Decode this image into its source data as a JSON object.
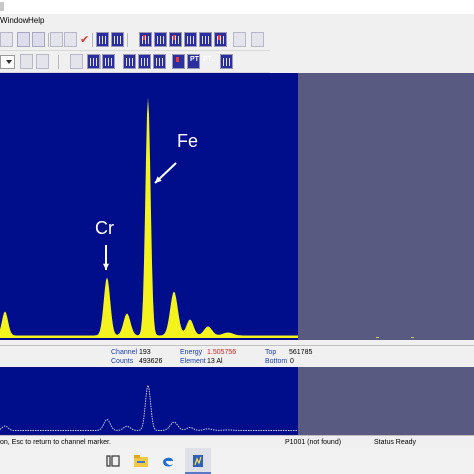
{
  "menubar": {
    "items": [
      "Window",
      "Help"
    ]
  },
  "toolbar": {
    "labels": [
      "PT",
      "PT.."
    ]
  },
  "spectrum": {
    "background_color": "#000e8c",
    "trace_color": "#f5f31e",
    "annotations": [
      {
        "element": "Cr"
      },
      {
        "element": "Fe"
      }
    ]
  },
  "info": {
    "channel_label": "Channel",
    "channel_value": "193",
    "counts_label": "Counts",
    "counts_value": "493626",
    "energy_label": "Energy",
    "energy_value": "1.505756",
    "element_label": "Element",
    "element_value": "13 Al",
    "top_label": "Top",
    "top_value": "561785",
    "bottom_label": "Bottom",
    "bottom_value": "0"
  },
  "status": {
    "hint": "on, Esc to return to channel marker.",
    "file": "P1001 (not found)",
    "state": "Status Ready"
  },
  "taskbar": {
    "icons": [
      "task-view-icon",
      "file-explorer-icon",
      "edge-icon",
      "app-icon"
    ]
  }
}
